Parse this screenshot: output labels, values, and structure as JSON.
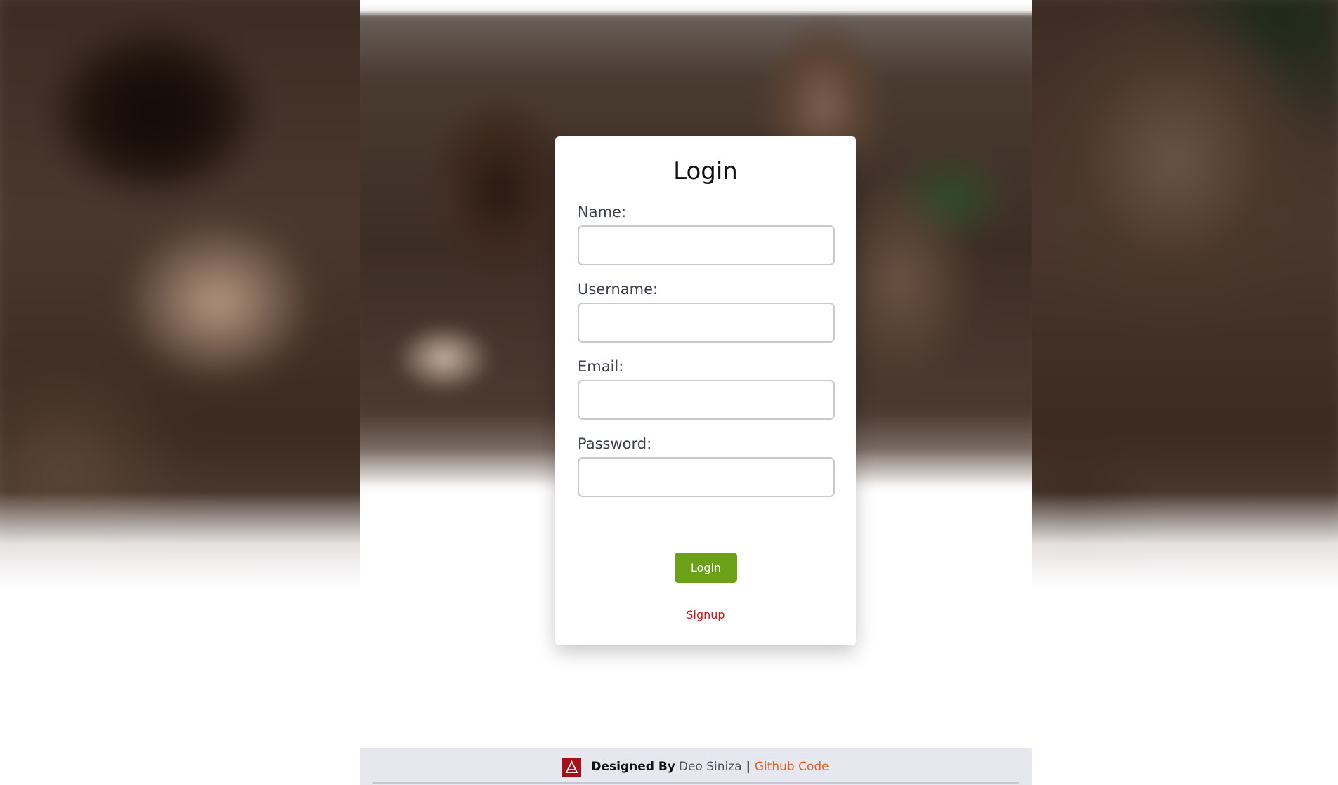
{
  "login_form": {
    "title": "Login",
    "fields": [
      {
        "label": "Name:",
        "value": "",
        "placeholder": ""
      },
      {
        "label": "Username:",
        "value": "",
        "placeholder": ""
      },
      {
        "label": "Email:",
        "value": "",
        "placeholder": ""
      },
      {
        "label": "Password:",
        "value": "",
        "placeholder": ""
      }
    ],
    "submit_label": "Login",
    "signup_label": "Signup"
  },
  "footer": {
    "logo_icon": "brand-logo-icon",
    "designed_by": "Designed By",
    "author": "Deo Siniza",
    "separator": "|",
    "github_label": "Github Code"
  },
  "colors": {
    "button": "#6aa117",
    "signup_link": "#d0121b",
    "github_link": "#e0601c",
    "logo": "#a3121b",
    "footer_bg": "#e7e8ef"
  }
}
